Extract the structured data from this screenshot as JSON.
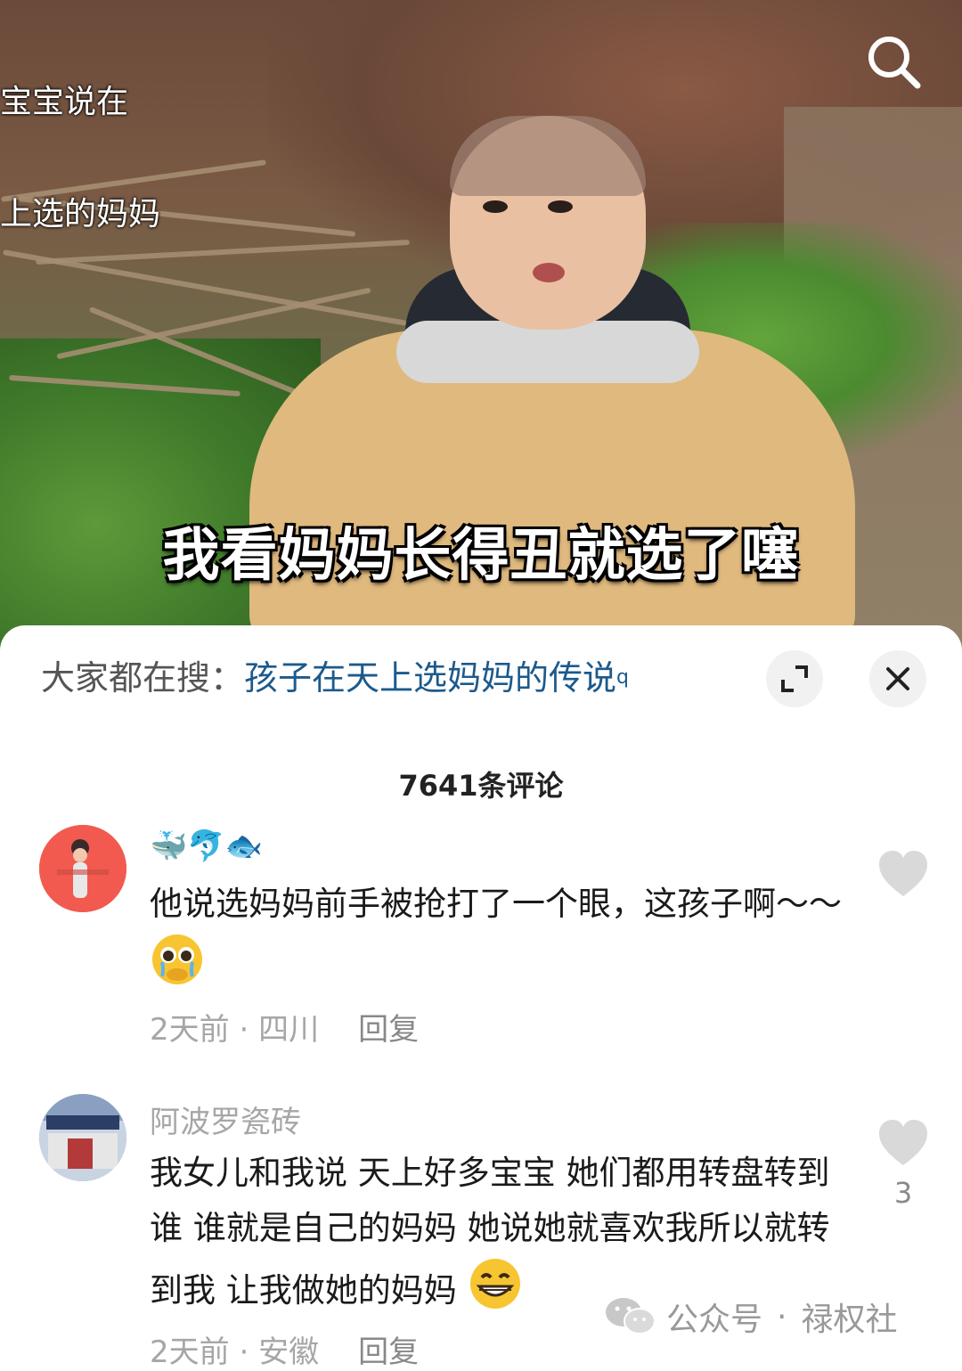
{
  "video": {
    "overlay_title_line1": "宝宝说在",
    "overlay_title_line2": "上选的妈妈",
    "subtitle": "我看妈妈长得丑就选了噻",
    "search_icon": "search-icon"
  },
  "search_suggest": {
    "label": "大家都在搜：",
    "keyword": "孩子在天上选妈妈的传说",
    "keyword_icon": "q",
    "expand_icon": "expand-icon",
    "close_icon": "close-icon"
  },
  "comments_header": {
    "count_text": "7641条评论"
  },
  "comments": [
    {
      "username": "🐳🐬🐟",
      "avatar_color": "#f25a4f",
      "text": "他说选妈妈前手被抢打了一个眼，这孩子啊～～",
      "emoji": "pleading-crying-emoji",
      "time": "2天前",
      "location": "四川",
      "reply_label": "回复",
      "like_count": ""
    },
    {
      "username": "阿波罗瓷砖",
      "avatar_color": "#8aa0c0",
      "text": "我女儿和我说 天上好多宝宝 她们都用转盘转到谁 谁就是自己的妈妈 她说她就喜欢我所以就转到我 让我做她的妈妈",
      "emoji": "grinning-emoji",
      "time": "2天前",
      "location": "安徽",
      "reply_label": "回复",
      "like_count": "3"
    }
  ],
  "watermark": {
    "brand": "公众号",
    "separator": "·",
    "name": "禄权社",
    "icon": "wechat-icon"
  },
  "colors": {
    "keyword": "#1c5a8c",
    "muted": "#a6a6a6",
    "text": "#1a1a1a"
  }
}
